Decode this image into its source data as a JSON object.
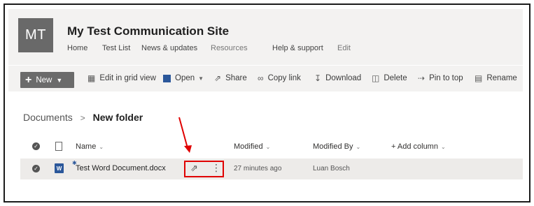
{
  "site": {
    "avatar_initials": "MT",
    "title": "My Test Communication Site",
    "nav": [
      "Home",
      "Test List",
      "News & updates",
      "Resources",
      "Help & support",
      "Edit"
    ]
  },
  "commands": {
    "new_label": "New",
    "edit_grid": "Edit in grid view",
    "open": "Open",
    "share": "Share",
    "copy_link": "Copy link",
    "download": "Download",
    "delete": "Delete",
    "pin": "Pin to top",
    "rename": "Rename"
  },
  "breadcrumb": {
    "root": "Documents",
    "separator": ">",
    "current": "New folder"
  },
  "columns": {
    "name": "Name",
    "modified": "Modified",
    "modified_by": "Modified By",
    "add_column": "+ Add column"
  },
  "rows": [
    {
      "name": "Test Word Document.docx",
      "modified": "27 minutes ago",
      "modified_by": "Luan Bosch",
      "file_icon": "word-doc-icon"
    }
  ],
  "colors": {
    "accent_word": "#2b579a",
    "highlight": "#e00000",
    "header_bg": "#f3f2f1",
    "row_selected_bg": "#edebe9"
  }
}
